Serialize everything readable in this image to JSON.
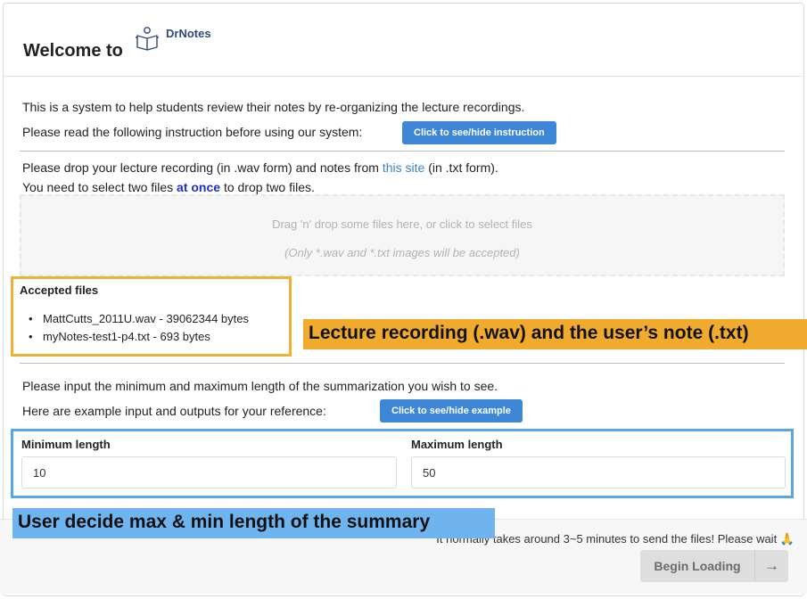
{
  "header": {
    "welcome": "Welcome to",
    "logo_text": "DrNotes",
    "logo_icon": "reading-person-icon"
  },
  "intro": {
    "line1": "This is a system to help students review their notes by re-organizing the lecture recordings.",
    "line2": "Please read the following instruction before using our system:",
    "instruction_button": "Click to see/hide instruction"
  },
  "upload": {
    "line1_prefix": "Please drop your lecture recording (in .wav form) and notes from ",
    "line1_link": "this site",
    "line1_suffix": " (in .txt form).",
    "line2_prefix": "You need to select two files ",
    "line2_emph": "at once",
    "line2_suffix": " to drop two files.",
    "dropzone_text": "Drag 'n' drop some files here, or click to select files",
    "dropzone_hint": "(Only *.wav and *.txt images will be accepted)"
  },
  "accepted": {
    "title": "Accepted files",
    "files": [
      "MattCutts_2011U.wav - 39062344 bytes",
      "myNotes-test1-p4.txt - 693 bytes"
    ]
  },
  "annotations": {
    "files_label": "Lecture recording (.wav) and the user’s note (.txt)",
    "length_label": "User decide max & min length of the summary"
  },
  "summary": {
    "line1": "Please input the minimum and maximum length of the summarization you wish to see.",
    "line2": "Here are example input and outputs for your reference:",
    "example_button": "Click to see/hide example",
    "min_label": "Minimum length",
    "min_value": "10",
    "max_label": "Maximum length",
    "max_value": "50"
  },
  "footer": {
    "note": "It normally takes around 3~5 minutes to send the files! Please wait",
    "emoji": "🙏",
    "begin_button": "Begin Loading",
    "arrow": "→"
  },
  "colors": {
    "accent": "#3d87d6",
    "orange_annotation": "#f0ab2e",
    "blue_annotation": "#6fb4ef"
  }
}
